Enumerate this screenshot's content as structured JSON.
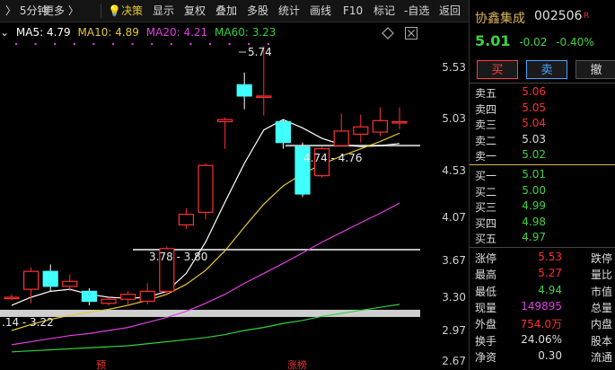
{
  "toolbar": {
    "period": "5分钟",
    "more": "更多 〉",
    "decision": "决策",
    "items": [
      "显示",
      "复权",
      "叠加",
      "多股",
      "统计",
      "画线",
      "F10",
      "标记",
      "-自选",
      "返回"
    ]
  },
  "ma": {
    "ma5": "MA5: 4.79",
    "ma10": "MA10: 4.89",
    "ma20": "MA20: 4.21",
    "ma60": "MA60: 3.23"
  },
  "colors": {
    "up": "#ff3030",
    "down": "#40ffff",
    "ma5": "#ffffff",
    "ma10": "#e8c832",
    "ma20": "#e040e0",
    "ma60": "#30d040",
    "price_green": "#3fd23f",
    "price_red": "#ff3030"
  },
  "chart_data": {
    "type": "candlestick",
    "y_ticks": [
      "5.53",
      "5.03",
      "4.53",
      "4.07",
      "3.67",
      "3.30",
      "2.97",
      "2.67"
    ],
    "candles": [
      {
        "o": 3.3,
        "c": 3.3,
        "h": 3.33,
        "l": 3.27
      },
      {
        "o": 3.38,
        "c": 3.56,
        "h": 3.6,
        "l": 3.24
      },
      {
        "o": 3.56,
        "c": 3.41,
        "h": 3.63,
        "l": 3.36
      },
      {
        "o": 3.41,
        "c": 3.46,
        "h": 3.53,
        "l": 3.36
      },
      {
        "o": 3.36,
        "c": 3.26,
        "h": 3.39,
        "l": 3.22
      },
      {
        "o": 3.24,
        "c": 3.28,
        "h": 3.3,
        "l": 3.22
      },
      {
        "o": 3.28,
        "c": 3.33,
        "h": 3.36,
        "l": 3.22
      },
      {
        "o": 3.26,
        "c": 3.36,
        "h": 3.44,
        "l": 3.23
      },
      {
        "o": 3.36,
        "c": 3.78,
        "h": 3.8,
        "l": 3.33
      },
      {
        "o": 4.0,
        "c": 4.1,
        "h": 4.16,
        "l": 3.96
      },
      {
        "o": 4.12,
        "c": 4.58,
        "h": 4.6,
        "l": 4.05
      },
      {
        "o": 5.0,
        "c": 5.02,
        "h": 5.04,
        "l": 4.74
      },
      {
        "o": 5.36,
        "c": 5.25,
        "h": 5.48,
        "l": 5.12
      },
      {
        "o": 5.24,
        "c": 5.25,
        "h": 5.74,
        "l": 5.06
      },
      {
        "o": 5.0,
        "c": 4.8,
        "h": 5.02,
        "l": 4.74
      },
      {
        "o": 4.76,
        "c": 4.3,
        "h": 4.8,
        "l": 4.27
      },
      {
        "o": 4.48,
        "c": 4.74,
        "h": 4.76,
        "l": 4.46
      },
      {
        "o": 4.77,
        "c": 4.91,
        "h": 5.08,
        "l": 4.76
      },
      {
        "o": 4.88,
        "c": 4.95,
        "h": 5.07,
        "l": 4.8
      },
      {
        "o": 4.9,
        "c": 5.01,
        "h": 5.14,
        "l": 4.86
      },
      {
        "o": 5.0,
        "c": 5.0,
        "h": 5.14,
        "l": 4.93
      }
    ],
    "ma_series": [
      {
        "name": "MA5",
        "values": [
          3.22,
          3.3,
          3.36,
          3.38,
          3.33,
          3.3,
          3.29,
          3.3,
          3.36,
          3.54,
          3.84,
          4.22,
          4.6,
          4.92,
          5.02,
          4.94,
          4.84,
          4.78,
          4.76,
          4.77,
          4.79
        ]
      },
      {
        "name": "MA10",
        "values": [
          2.97,
          3.03,
          3.08,
          3.12,
          3.15,
          3.18,
          3.22,
          3.27,
          3.33,
          3.43,
          3.57,
          3.76,
          3.98,
          4.2,
          4.38,
          4.5,
          4.59,
          4.67,
          4.74,
          4.81,
          4.89
        ]
      },
      {
        "name": "MA20",
        "values": [
          2.83,
          2.86,
          2.89,
          2.92,
          2.94,
          2.97,
          3.0,
          3.05,
          3.1,
          3.16,
          3.24,
          3.33,
          3.44,
          3.54,
          3.64,
          3.74,
          3.84,
          3.93,
          4.02,
          4.11,
          4.21
        ]
      },
      {
        "name": "MA60",
        "values": [
          2.76,
          2.77,
          2.78,
          2.79,
          2.8,
          2.81,
          2.82,
          2.84,
          2.86,
          2.88,
          2.9,
          2.93,
          2.97,
          3.0,
          3.04,
          3.07,
          3.11,
          3.14,
          3.17,
          3.2,
          3.23
        ]
      }
    ],
    "bands": [
      4.77,
      3.77,
      3.14
    ],
    "annotations": [
      "5.74",
      "4.74 - 4.76",
      "3.78 - 3.80",
      ".14 - 3.22"
    ],
    "bottom_markers": [
      "预",
      "涨榜"
    ]
  },
  "stock": {
    "name": "协鑫集成",
    "code": "002506",
    "flag": "R",
    "price": "5.01",
    "change": "-0.02",
    "pct": "-0.40%"
  },
  "buttons": {
    "buy": "买",
    "sell": "卖",
    "cancel": "撤"
  },
  "orderbook": {
    "asks": [
      {
        "label": "卖五",
        "price": "5.06",
        "color": "#ff3030"
      },
      {
        "label": "卖四",
        "price": "5.05",
        "color": "#ff3030"
      },
      {
        "label": "卖三",
        "price": "5.04",
        "color": "#ff3030"
      },
      {
        "label": "卖二",
        "price": "5.03",
        "color": "#dddddd"
      },
      {
        "label": "卖一",
        "price": "5.02",
        "color": "#3fd23f"
      }
    ],
    "bids": [
      {
        "label": "买一",
        "price": "5.01",
        "color": "#3fd23f"
      },
      {
        "label": "买二",
        "price": "5.00",
        "color": "#3fd23f"
      },
      {
        "label": "买三",
        "price": "4.99",
        "color": "#3fd23f"
      },
      {
        "label": "买四",
        "price": "4.98",
        "color": "#3fd23f"
      },
      {
        "label": "买五",
        "price": "4.97",
        "color": "#3fd23f"
      }
    ]
  },
  "stats": [
    {
      "k1": "涨停",
      "v1": "5.53",
      "color": "#ff3030",
      "k2": "跌停"
    },
    {
      "k1": "最高",
      "v1": "5.27",
      "color": "#ff3030",
      "k2": "量比"
    },
    {
      "k1": "最低",
      "v1": "4.94",
      "color": "#3fd23f",
      "k2": "市值"
    },
    {
      "k1": "现量",
      "v1": "149895",
      "color": "#e040e0",
      "k2": "总量"
    },
    {
      "k1": "外盘",
      "v1": "754.0万",
      "color": "#ff3030",
      "k2": "内盘"
    },
    {
      "k1": "换手",
      "v1": "24.06%",
      "color": "#dddddd",
      "k2": "股本"
    },
    {
      "k1": "净资",
      "v1": "0.30",
      "color": "#dddddd",
      "k2": "流通"
    }
  ]
}
